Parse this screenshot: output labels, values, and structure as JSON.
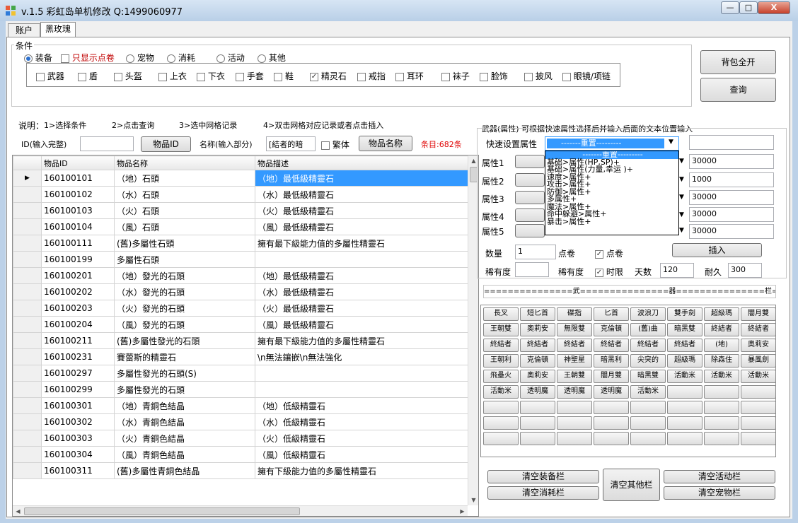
{
  "window": {
    "title": "v.1.5 彩虹岛单机修改 Q:1499060977",
    "min": "—",
    "max": "□",
    "close": "X"
  },
  "tabs": [
    {
      "label": "账户"
    },
    {
      "label": "黑玫瑰"
    }
  ],
  "condition": {
    "legend": "条件",
    "radios": [
      {
        "label": "装备",
        "checked": true
      },
      {
        "label": "宠物",
        "checked": false
      },
      {
        "label": "消耗",
        "checked": false
      },
      {
        "label": "活动",
        "checked": false
      },
      {
        "label": "其他",
        "checked": false
      }
    ],
    "only_dianjuan": {
      "label": "只显示点卷",
      "checked": false
    },
    "categories": [
      {
        "label": "武器",
        "checked": false
      },
      {
        "label": "盾",
        "checked": false
      },
      {
        "label": "头盔",
        "checked": false
      },
      {
        "label": "上衣",
        "checked": false
      },
      {
        "label": "下衣",
        "checked": false
      },
      {
        "label": "手套",
        "checked": false
      },
      {
        "label": "鞋",
        "checked": false
      },
      {
        "label": "精灵石",
        "checked": true
      },
      {
        "label": "戒指",
        "checked": false
      },
      {
        "label": "耳环",
        "checked": false
      },
      {
        "label": "袜子",
        "checked": false
      },
      {
        "label": "脸饰",
        "checked": false
      },
      {
        "label": "披风",
        "checked": false
      },
      {
        "label": "眼镜/项链",
        "checked": false
      }
    ]
  },
  "buttons": {
    "open_bag": "背包全开",
    "query": "查询",
    "item_id": "物品ID",
    "item_name": "物品名称",
    "insert": "插入"
  },
  "instructions": {
    "title": "说明：",
    "step1": "1>选择条件",
    "step2": "2>点击查询",
    "step3": "3>选中网格记录",
    "step4": "4>双击网格对应记录或者点击插入"
  },
  "search": {
    "id_label": "ID(输入完整)",
    "id_value": "",
    "name_label": "名称(输入部分)",
    "name_value": "[結者的暗",
    "traditional": {
      "label": "繁体",
      "checked": false
    },
    "count": "条目:682条"
  },
  "grid": {
    "columns": [
      "物品ID",
      "物品名称",
      "物品描述"
    ],
    "rows": [
      {
        "id": "160100101",
        "name": "（地）石頭",
        "desc": "（地）最低級精靈石"
      },
      {
        "id": "160100102",
        "name": "（水）石頭",
        "desc": "（水）最低級精靈石"
      },
      {
        "id": "160100103",
        "name": "（火）石頭",
        "desc": "（火）最低級精靈石"
      },
      {
        "id": "160100104",
        "name": "（風）石頭",
        "desc": "（風）最低級精靈石"
      },
      {
        "id": "160100111",
        "name": "(舊)多屬性石頭",
        "desc": "擁有最下級能力值的多屬性精靈石"
      },
      {
        "id": "160100199",
        "name": "多屬性石頭",
        "desc": ""
      },
      {
        "id": "160100201",
        "name": "（地）發光的石頭",
        "desc": "（地）最低級精靈石"
      },
      {
        "id": "160100202",
        "name": "（水）發光的石頭",
        "desc": "（水）最低級精靈石"
      },
      {
        "id": "160100203",
        "name": "（火）發光的石頭",
        "desc": "（火）最低級精靈石"
      },
      {
        "id": "160100204",
        "name": "（風）發光的石頭",
        "desc": "（風）最低級精靈石"
      },
      {
        "id": "160100211",
        "name": "(舊)多屬性發光的石頭",
        "desc": "擁有最下級能力值的多屬性精靈石"
      },
      {
        "id": "160100231",
        "name": "賽蕾斯的精靈石",
        "desc": "\\n無法鑲嵌\\n無法強化"
      },
      {
        "id": "160100297",
        "name": "多屬性發光的石頭(S)",
        "desc": ""
      },
      {
        "id": "160100299",
        "name": "多屬性發光的石頭",
        "desc": ""
      },
      {
        "id": "160100301",
        "name": "（地）青銅色結晶",
        "desc": "（地）低級精靈石"
      },
      {
        "id": "160100302",
        "name": "（水）青銅色結晶",
        "desc": "（水）低級精靈石"
      },
      {
        "id": "160100303",
        "name": "（火）青銅色結晶",
        "desc": "（火）低級精靈石"
      },
      {
        "id": "160100304",
        "name": "（風）青銅色結晶",
        "desc": "（風）低級精靈石"
      },
      {
        "id": "160100311",
        "name": "(舊)多屬性青銅色結晶",
        "desc": "擁有下級能力值的多屬性精靈石"
      }
    ]
  },
  "attributes": {
    "header": "武器(属性) 可根据快速属性选择后并输入后面的文本位置输入",
    "quick_label": "快速设置属性",
    "quick_value": "-------重置---------",
    "dropdown_options": [
      "-------重置---------",
      "基础>属性(HP,SP)+",
      "基础>属性(力量,幸运 )+",
      "速度>属性+",
      "攻击>属性+",
      "防御>属性+",
      "多属性+",
      "魔法>属性+",
      "命中躲避>属性+",
      "暴击>属性+"
    ],
    "rows": [
      {
        "label": "属性1",
        "value": "30000"
      },
      {
        "label": "属性2",
        "value": "1000"
      },
      {
        "label": "属性3",
        "value": "30000"
      },
      {
        "label": "属性4",
        "value": "30000"
      },
      {
        "label": "属性5",
        "value": "30000"
      }
    ],
    "quantity_label": "数量",
    "quantity_value": "1",
    "dianjuan_label": "点卷",
    "dianjuan_check": {
      "label": "点卷",
      "checked": true
    },
    "rarity1_label": "稀有度",
    "rarity1_value": "",
    "rarity2_label": "稀有度",
    "time_limit": {
      "label": "时限",
      "checked": true
    },
    "days_label": "天数",
    "days_value": "120",
    "durability_label": "耐久",
    "durability_value": "300"
  },
  "weapon_bar": {
    "title": "===============武===============器===============栏==============",
    "items": [
      "長叉",
      "短匕首",
      "碟指",
      "匕首",
      "波浪刀",
      "雙手劍",
      "超級瑪",
      "闇月雙",
      "王朝雙",
      "奧莉安",
      "無限雙",
      "克倫頓",
      "(舊)曲",
      "暗黑雙",
      "終結者",
      "終結者",
      "終結者",
      "終結者",
      "終結者",
      "終結者",
      "終結者",
      "終結者",
      "(地)",
      "奧莉安",
      "王朝利",
      "克倫頓",
      "神聖星",
      "暗黑利",
      "尖突的",
      "超級瑪",
      "除森住",
      "暴風劍",
      "飛壘火",
      "奧莉安",
      "王朝雙",
      "闇月雙",
      "暗黑雙",
      "活動米",
      "活動米",
      "活動米",
      "活動米",
      "透明魔",
      "透明魔",
      "透明魔",
      "活動米",
      "",
      "",
      "",
      "",
      "",
      "",
      "",
      "",
      "",
      "",
      "",
      "",
      "",
      "",
      "",
      "",
      "",
      "",
      "",
      "",
      "",
      "",
      "",
      "",
      "",
      "",
      ""
    ]
  },
  "clear_buttons": {
    "equip": "清空装备栏",
    "consume": "清空消耗栏",
    "other": "清空其他栏",
    "event": "清空活动栏",
    "pet": "清空宠物栏"
  }
}
